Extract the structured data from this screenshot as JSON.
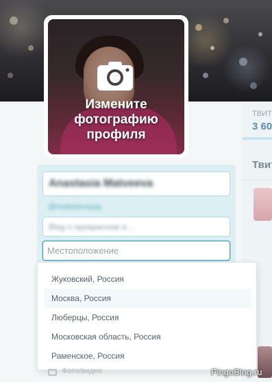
{
  "avatar": {
    "change_photo_text": "Измените фотографию профиля"
  },
  "stats": {
    "label": "ТВИТЫ",
    "value": "3 60"
  },
  "right_column": {
    "heading": "Твиты"
  },
  "profile_form": {
    "name_value": "Anastasia Matveeva",
    "handle": "@matveevaaa",
    "bio_value": "Blog о прекрасном и…",
    "location_placeholder": "Местоположение"
  },
  "location_suggestions": [
    {
      "label": "Жуковский, Россия"
    },
    {
      "label": "Москва, Россия"
    },
    {
      "label": "Люберцы, Россия"
    },
    {
      "label": "Московская область, Россия"
    },
    {
      "label": "Раменское, Россия"
    }
  ],
  "footer": {
    "photo_video_label": "Фото/видео"
  },
  "watermark": "PingoBlog.ru",
  "colors": {
    "accent": "#4f9fb7",
    "edit_panel_bg": "#dcf0f3"
  }
}
